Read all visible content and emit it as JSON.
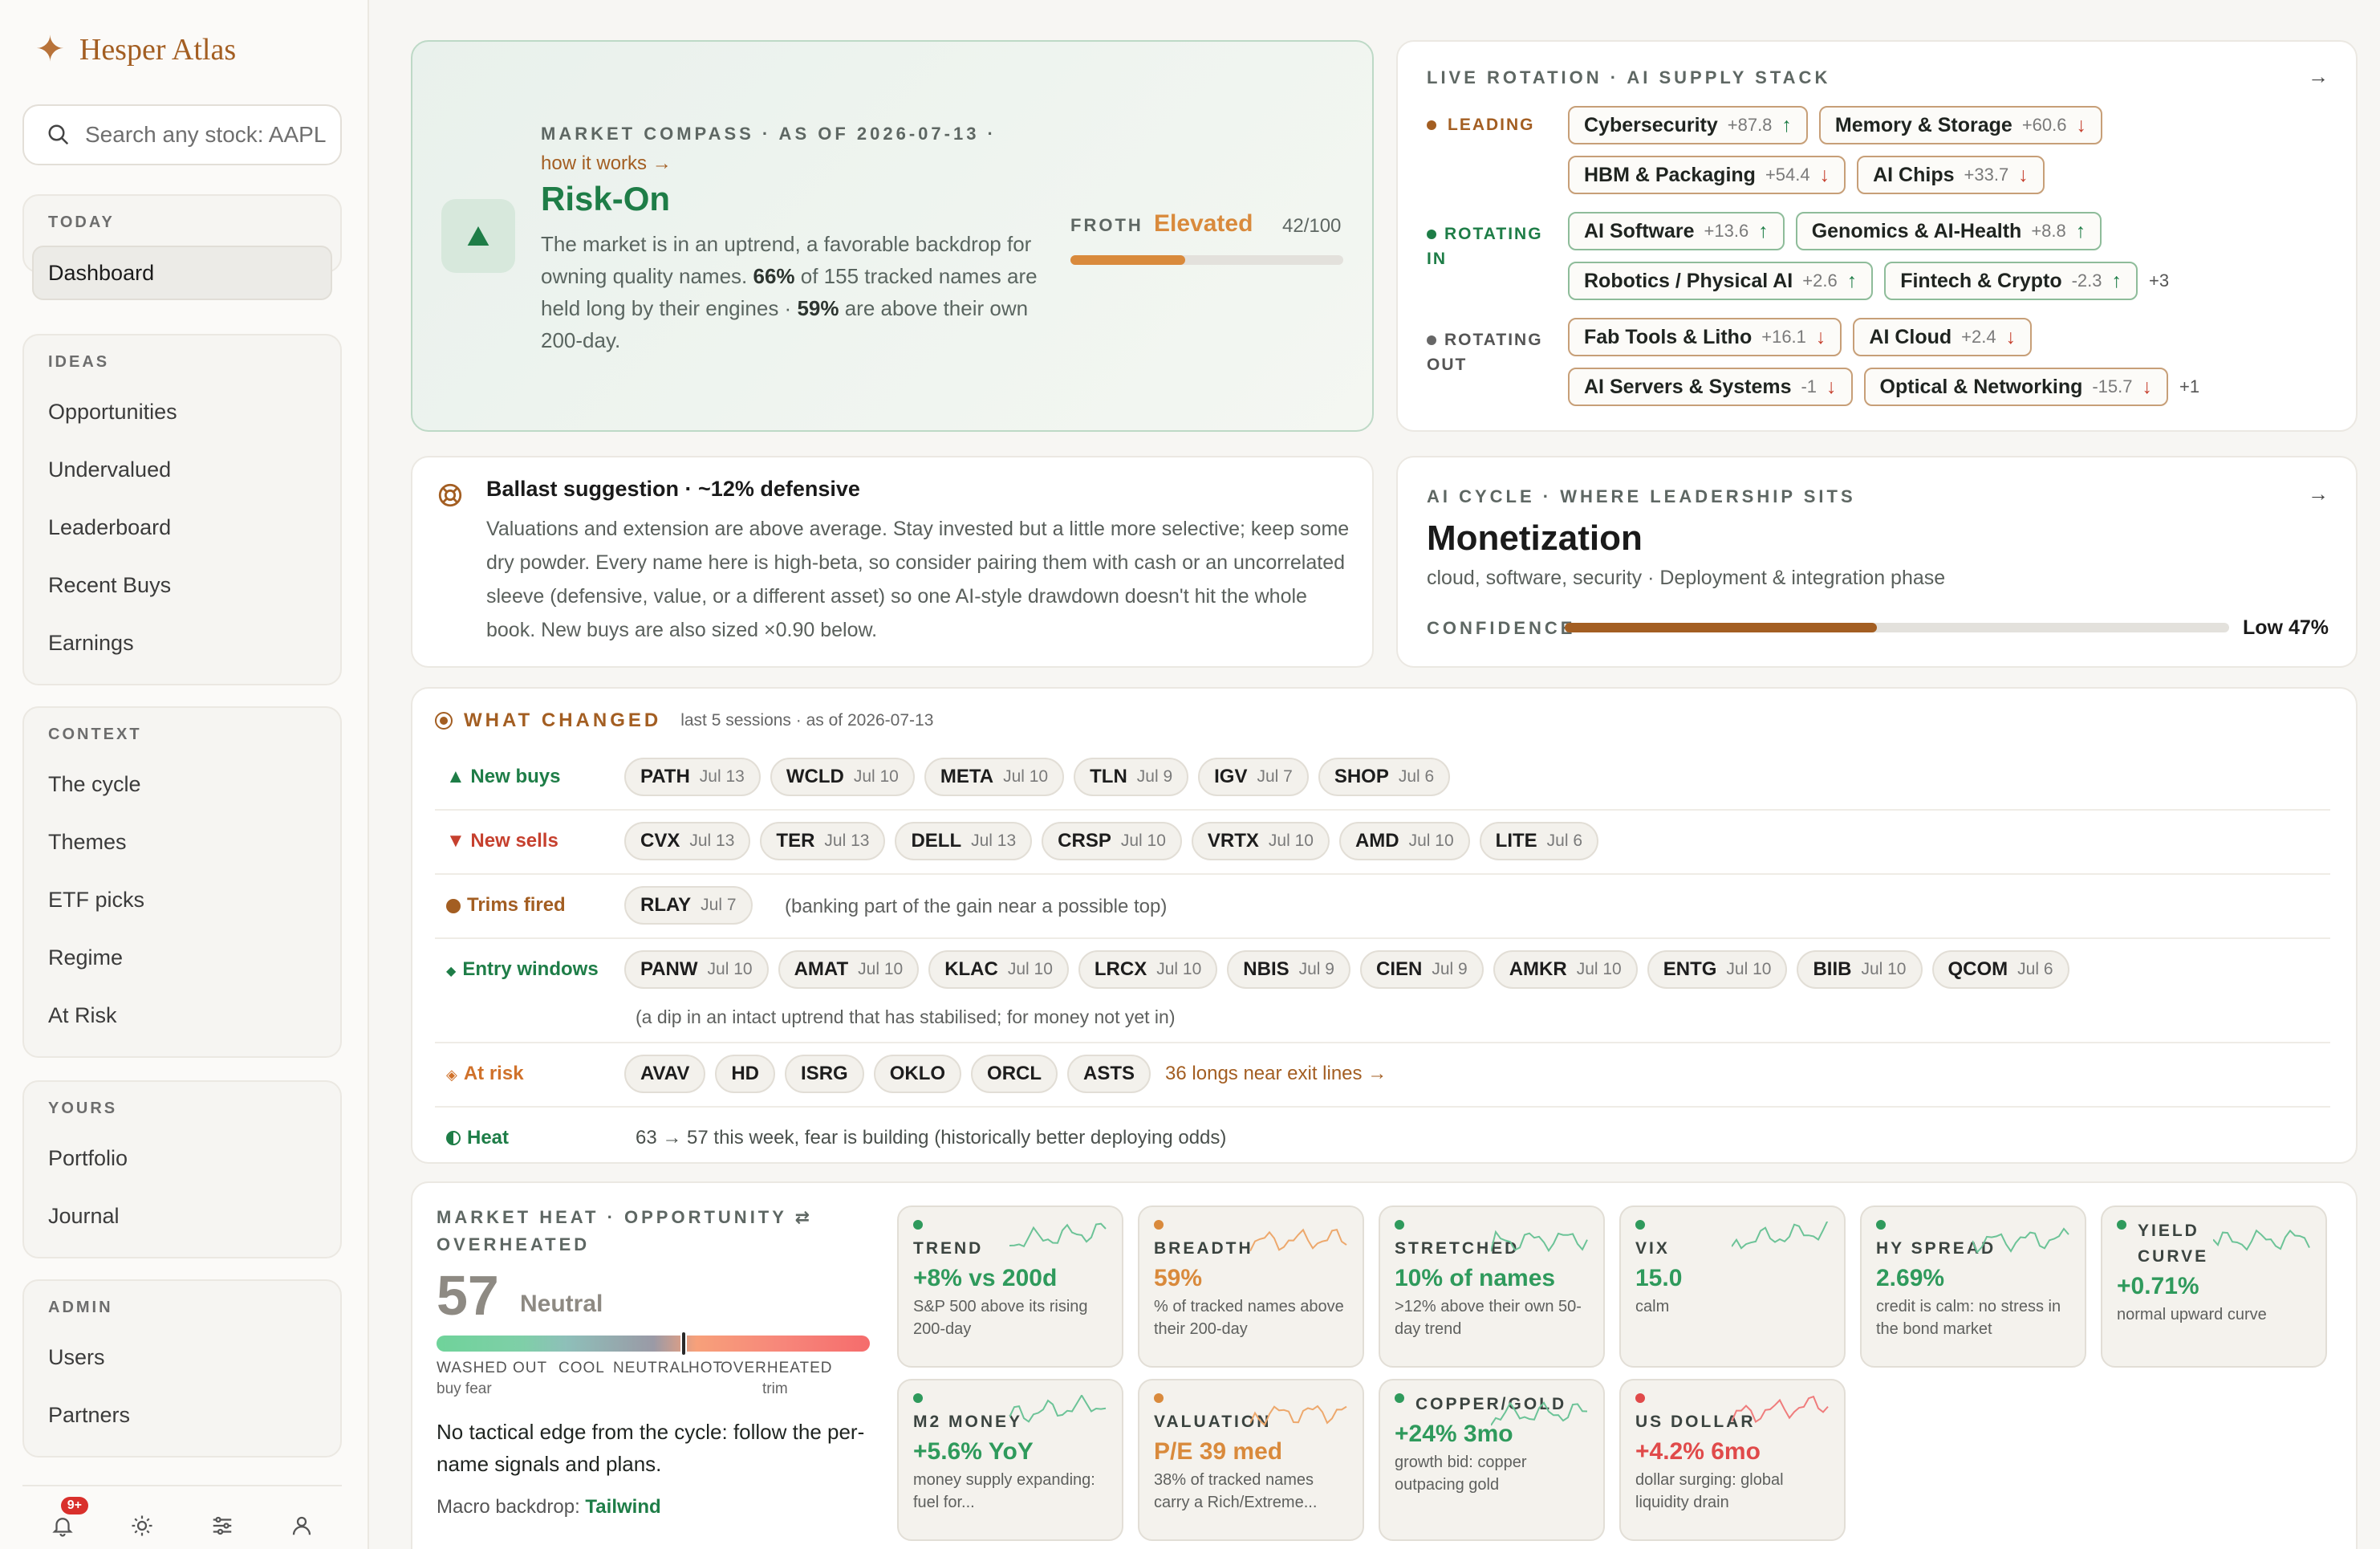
{
  "app": {
    "name": "Hesper Atlas"
  },
  "search": {
    "placeholder": "Search any stock: AAPL"
  },
  "nav": {
    "today": {
      "header": "TODAY",
      "items": [
        "Dashboard"
      ]
    },
    "ideas": {
      "header": "IDEAS",
      "items": [
        "Opportunities",
        "Undervalued",
        "Leaderboard",
        "Recent Buys",
        "Earnings"
      ]
    },
    "context": {
      "header": "CONTEXT",
      "items": [
        "The cycle",
        "Themes",
        "ETF picks",
        "Regime",
        "At Risk"
      ]
    },
    "yours": {
      "header": "YOURS",
      "items": [
        "Portfolio",
        "Journal"
      ]
    },
    "admin": {
      "header": "ADMIN",
      "items": [
        "Users",
        "Partners"
      ]
    },
    "notifications_badge": "9+"
  },
  "compass": {
    "kicker": "MARKET COMPASS · AS OF 2026-07-13 ·",
    "link": "how it works →",
    "regime": "Risk-On",
    "text_a": "The market is in an uptrend, a favorable backdrop for owning quality names. ",
    "pct_long": "66%",
    "text_b": " of 155 tracked names are held long by their engines · ",
    "pct_200": "59%",
    "text_c": " are above their own 200-day.",
    "froth_label": "FROTH",
    "froth_value": "Elevated",
    "froth_score": "42/100",
    "froth_fraction": 0.42
  },
  "rotation": {
    "kicker": "LIVE ROTATION · AI SUPPLY STACK",
    "leading_label": "LEADING",
    "rotating_in_label": "ROTATING IN",
    "rotating_out_label": "ROTATING OUT",
    "leading": [
      {
        "name": "Cybersecurity",
        "value": "+87.8",
        "dir": "up"
      },
      {
        "name": "Memory & Storage",
        "value": "+60.6",
        "dir": "down"
      },
      {
        "name": "HBM & Packaging",
        "value": "+54.4",
        "dir": "down"
      },
      {
        "name": "AI Chips",
        "value": "+33.7",
        "dir": "down"
      }
    ],
    "rotating_in": [
      {
        "name": "AI Software",
        "value": "+13.6",
        "dir": "up"
      },
      {
        "name": "Genomics & AI-Health",
        "value": "+8.8",
        "dir": "up"
      },
      {
        "name": "Robotics / Physical AI",
        "value": "+2.6",
        "dir": "up"
      },
      {
        "name": "Fintech & Crypto",
        "value": "-2.3",
        "dir": "up"
      }
    ],
    "rotating_in_more": "+3",
    "rotating_out": [
      {
        "name": "Fab Tools & Litho",
        "value": "+16.1",
        "dir": "down"
      },
      {
        "name": "AI Cloud",
        "value": "+2.4",
        "dir": "down"
      },
      {
        "name": "AI Servers & Systems",
        "value": "-1",
        "dir": "down"
      },
      {
        "name": "Optical & Networking",
        "value": "-15.7",
        "dir": "down"
      }
    ],
    "rotating_out_more": "+1"
  },
  "ballast": {
    "title": "Ballast suggestion · ~12% defensive",
    "body": "Valuations and extension are above average. Stay invested but a little more selective; keep some dry powder. Every name here is high-beta, so consider pairing them with cash or an uncorrelated sleeve (defensive, value, or a different asset) so one AI-style drawdown doesn't hit the whole book. New buys are also sized ×0.90 below."
  },
  "cycle": {
    "kicker": "AI CYCLE · WHERE LEADERSHIP SITS",
    "phase": "Monetization",
    "sub": "cloud, software, security · Deployment & integration phase",
    "confidence_label": "CONFIDENCE",
    "confidence_value": "Low 47%",
    "confidence_fraction": 0.47
  },
  "changed": {
    "title": "WHAT CHANGED",
    "sub": "last 5 sessions · as of 2026-07-13",
    "new_buys_label": "▲ New buys",
    "new_buys": [
      [
        "PATH",
        "Jul 13"
      ],
      [
        "WCLD",
        "Jul 10"
      ],
      [
        "META",
        "Jul 10"
      ],
      [
        "TLN",
        "Jul 9"
      ],
      [
        "IGV",
        "Jul 7"
      ],
      [
        "SHOP",
        "Jul 6"
      ]
    ],
    "new_sells_label": "▼ New sells",
    "new_sells": [
      [
        "CVX",
        "Jul 13"
      ],
      [
        "TER",
        "Jul 13"
      ],
      [
        "DELL",
        "Jul 13"
      ],
      [
        "CRSP",
        "Jul 10"
      ],
      [
        "VRTX",
        "Jul 10"
      ],
      [
        "AMD",
        "Jul 10"
      ],
      [
        "LITE",
        "Jul 6"
      ]
    ],
    "trims_label": "Trims fired",
    "trims": [
      [
        "RLAY",
        "Jul 7"
      ]
    ],
    "trims_note": "(banking part of the gain near a possible top)",
    "entry_label": "Entry windows",
    "entry": [
      [
        "PANW",
        "Jul 10"
      ],
      [
        "AMAT",
        "Jul 10"
      ],
      [
        "KLAC",
        "Jul 10"
      ],
      [
        "LRCX",
        "Jul 10"
      ],
      [
        "NBIS",
        "Jul 9"
      ],
      [
        "CIEN",
        "Jul 9"
      ],
      [
        "AMKR",
        "Jul 10"
      ],
      [
        "ENTG",
        "Jul 10"
      ],
      [
        "BIIB",
        "Jul 10"
      ],
      [
        "QCOM",
        "Jul 6"
      ]
    ],
    "entry_note": "(a dip in an intact uptrend that has stabilised; for money not yet in)",
    "risk_label": "At risk",
    "risk": [
      "AVAV",
      "HD",
      "ISRG",
      "OKLO",
      "ORCL",
      "ASTS"
    ],
    "risk_link": "36 longs near exit lines →",
    "heat_label": "Heat",
    "heat_text": "63 → 57 this week, fear is building (historically better deploying odds)"
  },
  "heat": {
    "kicker": "MARKET HEAT · OPPORTUNITY ⇄",
    "kicker2": "OVERHEATED",
    "score": "57",
    "score_label": "Neutral",
    "gauge_fraction": 0.57,
    "scale": [
      "WASHED OUT",
      "COOL",
      "NEUTRAL",
      "HOT",
      "OVERHEATED"
    ],
    "scale_sub_left": "buy fear",
    "scale_sub_right": "trim",
    "advice": "No tactical edge from the cycle: follow the per-name signals and plans.",
    "macro_label": "Macro backdrop: ",
    "macro_value": "Tailwind"
  },
  "tiles": [
    {
      "title": "TREND",
      "value": "+8% vs 200d",
      "desc": "S&P 500 above its rising 200-day",
      "color": "#2f9a5c"
    },
    {
      "title": "BREADTH",
      "value": "59%",
      "desc": "% of tracked names above their 200-day",
      "color": "#d98a3c"
    },
    {
      "title": "STRETCHED",
      "value": "10% of names",
      "desc": ">12% above their own 50-day trend",
      "color": "#2f9a5c"
    },
    {
      "title": "VIX",
      "value": "15.0",
      "desc": "calm",
      "color": "#2f9a5c"
    },
    {
      "title": "HY SPREAD",
      "value": "2.69%",
      "desc": "credit is calm: no stress in the bond market",
      "color": "#2f9a5c"
    },
    {
      "title": "YIELD CURVE",
      "value": "+0.71%",
      "desc": "normal upward curve",
      "color": "#2f9a5c"
    },
    {
      "title": "M2 MONEY",
      "value": "+5.6% YoY",
      "desc": "money supply expanding: fuel for...",
      "color": "#2f9a5c"
    },
    {
      "title": "VALUATION",
      "value": "P/E 39 med",
      "desc": "38% of tracked names carry a Rich/Extreme...",
      "color": "#d98a3c"
    },
    {
      "title": "COPPER/GOLD",
      "value": "+24% 3mo",
      "desc": "growth bid: copper outpacing gold",
      "color": "#2f9a5c"
    },
    {
      "title": "US DOLLAR",
      "value": "+4.2% 6mo",
      "desc": "dollar surging: global liquidity drain",
      "color": "#e04a4a"
    }
  ],
  "colors": {
    "accent": "#a35e22",
    "green": "#1e7d47",
    "red": "#c6402e",
    "orange": "#d98a3c"
  }
}
